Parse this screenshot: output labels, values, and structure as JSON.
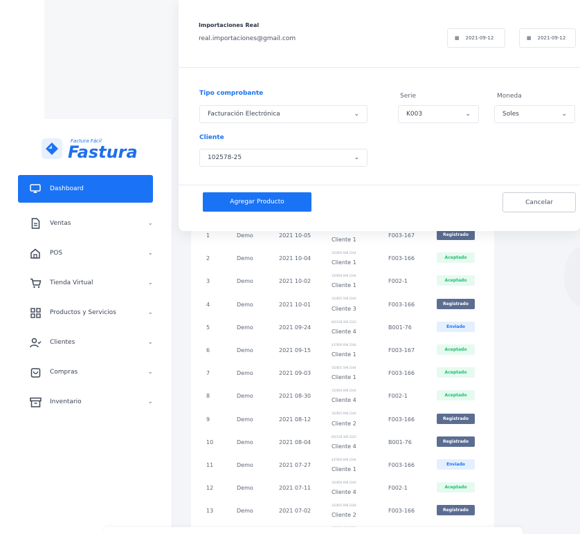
{
  "brand": {
    "tagline": "Factura Fácil",
    "name": "Fastura"
  },
  "sidebar": {
    "items": [
      {
        "label": "Dashboard",
        "icon": "monitor-icon",
        "active": true
      },
      {
        "label": "Ventas",
        "icon": "document-icon"
      },
      {
        "label": "POS",
        "icon": "home-icon"
      },
      {
        "label": "Tienda Virtual",
        "icon": "cart-icon"
      },
      {
        "label": "Productos y Servicios",
        "icon": "grid-icon"
      },
      {
        "label": "Clientes",
        "icon": "user-icon"
      },
      {
        "label": "Compras",
        "icon": "bag-icon"
      },
      {
        "label": "Inventario",
        "icon": "archive-icon"
      }
    ]
  },
  "modal": {
    "company": "Importaciones Real",
    "email": "real.importaciones@gmail.com",
    "date_from": "2021-09-12",
    "date_to": "2021-09-12",
    "tipo_label": "Tipo comprobante",
    "tipo_value": "Facturación Electrónica",
    "serie_label": "Serie",
    "serie_value": "K003",
    "moneda_label": "Moneda",
    "moneda_value": "Soles",
    "cliente_label": "Cliente",
    "cliente_value": "102578-25",
    "add_button": "Agregar Producto",
    "cancel_button": "Cancelar"
  },
  "table": {
    "rows": [
      {
        "num": "1",
        "user": "Demo",
        "date": "2021 10-05",
        "client": "Cliente 1",
        "client_sub": "102856 698 2344",
        "serie": "F003-167",
        "status": "Registrado"
      },
      {
        "num": "2",
        "user": "Demo",
        "date": "2021 10-04",
        "client": "Cliente 1",
        "client_sub": "102856 698 2344",
        "serie": "F003-166",
        "status": "Aceptado"
      },
      {
        "num": "3",
        "user": "Demo",
        "date": "2021 10-02",
        "client": "Cliente 1",
        "client_sub": "102855 598 2344",
        "serie": "F002-1",
        "status": "Aceptado"
      },
      {
        "num": "4",
        "user": "Demo",
        "date": "2021 10-01",
        "client": "Cliente 3",
        "client_sub": "602128 409 2323",
        "serie": "F003-166",
        "status": "Registrado"
      },
      {
        "num": "5",
        "user": "Demo",
        "date": "2021 09-24",
        "client": "Cliente 4",
        "client_sub": "437600 698 2344",
        "serie": "B001-76",
        "status": "Enviado"
      },
      {
        "num": "6",
        "user": "Demo",
        "date": "2021 09-15",
        "client": "Cliente 1",
        "client_sub": "102855 598 2344",
        "serie": "F003-167",
        "status": "Aceptado"
      },
      {
        "num": "7",
        "user": "Demo",
        "date": "2021 09-03",
        "client": "Cliente 1",
        "client_sub": "102856 698 2344",
        "serie": "F003-166",
        "status": "Aceptado"
      },
      {
        "num": "8",
        "user": "Demo",
        "date": "2021 08-30",
        "client": "Cliente 4",
        "client_sub": "102855 698 2344",
        "serie": "F002-1",
        "status": "Aceptado"
      },
      {
        "num": "9",
        "user": "Demo",
        "date": "2021 08-12",
        "client": "Cliente 2",
        "client_sub": "602128 409 2323",
        "serie": "F003-166",
        "status": "Registrado"
      },
      {
        "num": "10",
        "user": "Demo",
        "date": "2021 08-04",
        "client": "Cliente 4",
        "client_sub": "437600 698 2344",
        "serie": "B001-76",
        "status": "Registrado"
      },
      {
        "num": "11",
        "user": "Demo",
        "date": "2021 07-27",
        "client": "Cliente 1",
        "client_sub": "102856 698 2344",
        "serie": "F003-166",
        "status": "Enviado"
      },
      {
        "num": "12",
        "user": "Demo",
        "date": "2021 07-11",
        "client": "Cliente 4",
        "client_sub": "102855 698 2344",
        "serie": "F002-1",
        "status": "Aceptado"
      },
      {
        "num": "13",
        "user": "Demo",
        "date": "2021 07-02",
        "client": "Cliente 2",
        "client_sub": "602128 409 2323",
        "serie": "F003-166",
        "status": "Registrado"
      }
    ]
  },
  "colors": {
    "accent": "#1a73f5",
    "registrado": "#5b6d91",
    "aceptado": "#1fbf6e",
    "enviado": "#1a73f5"
  }
}
